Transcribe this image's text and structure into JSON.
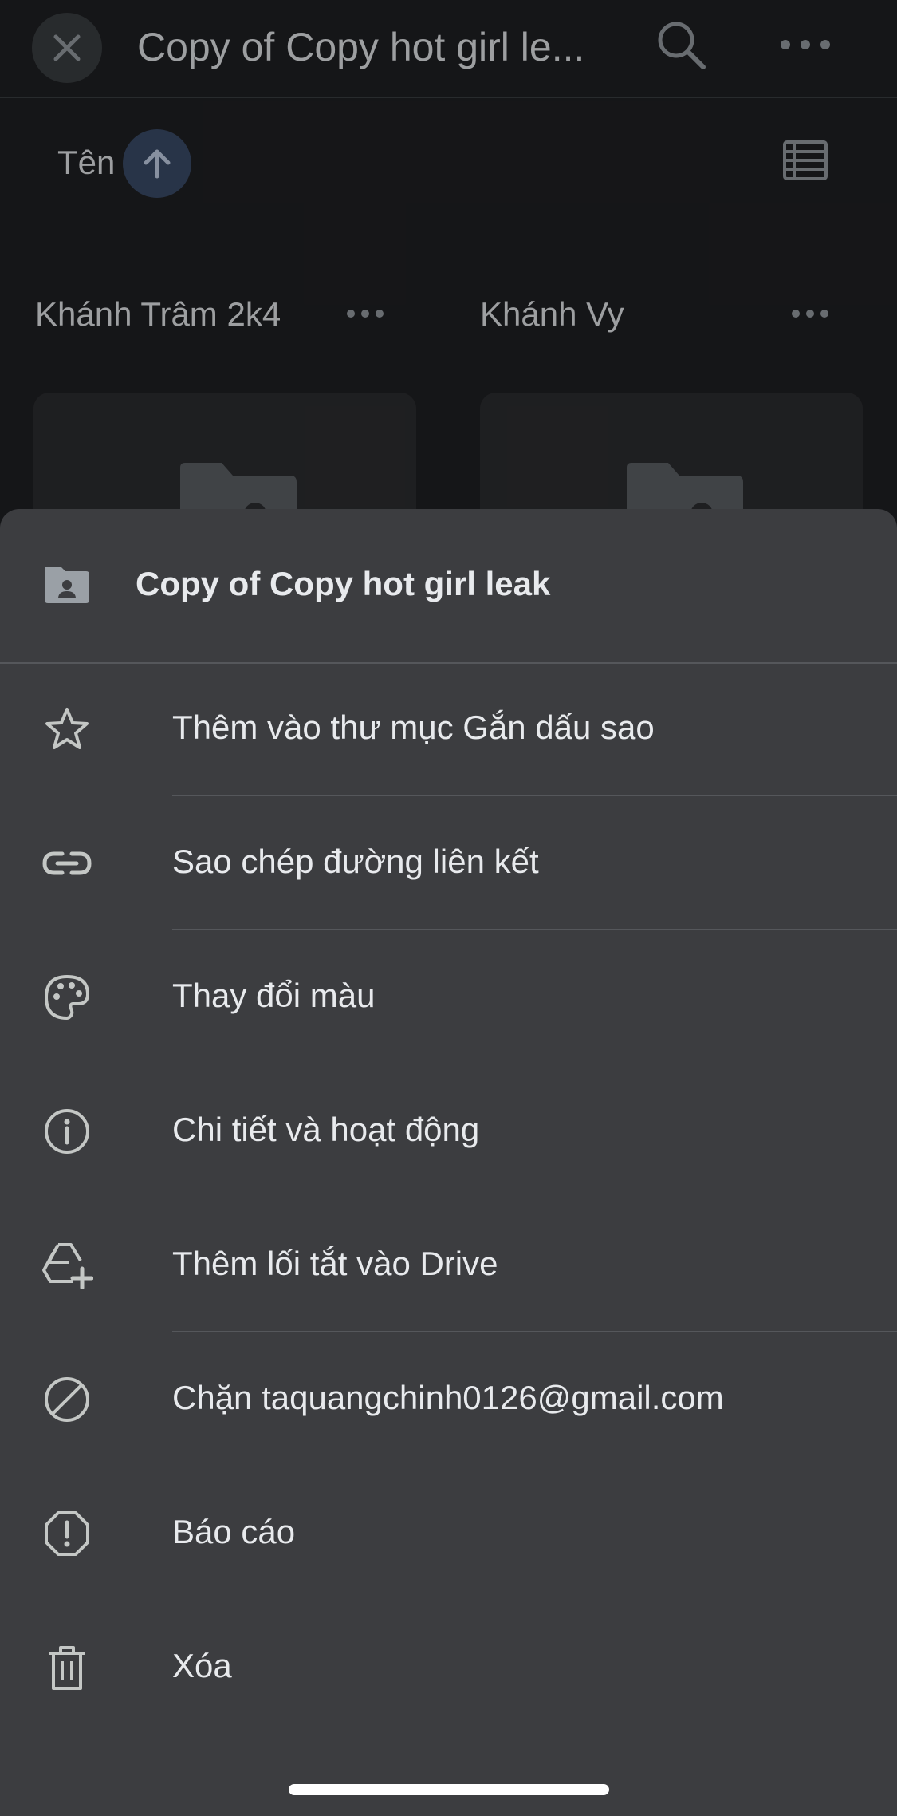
{
  "top_bar": {
    "title": "Copy of Copy hot girl le...",
    "close_icon": "close-icon",
    "search_icon": "search-icon",
    "more_icon": "more-horiz-icon"
  },
  "sort": {
    "label": "Tên",
    "direction_icon": "arrow-up-icon",
    "view_icon": "list-view-icon"
  },
  "folders": [
    {
      "name": "Khánh Trâm 2k4"
    },
    {
      "name": "Khánh Vy"
    }
  ],
  "sheet": {
    "title": "Copy of Copy hot girl leak",
    "title_icon": "shared-folder-icon",
    "items": [
      {
        "label": "Thêm vào thư mục Gắn dấu sao",
        "icon": "star-icon"
      },
      {
        "label": "Sao chép đường liên kết",
        "icon": "link-icon"
      },
      {
        "label": "Thay đổi màu",
        "icon": "palette-icon"
      },
      {
        "label": "Chi tiết và hoạt động",
        "icon": "info-icon"
      },
      {
        "label": "Thêm lối tắt vào Drive",
        "icon": "add-to-drive-icon"
      },
      {
        "label": "Chặn taquangchinh0126@gmail.com",
        "icon": "block-icon"
      },
      {
        "label": "Báo cáo",
        "icon": "report-icon"
      },
      {
        "label": "Xóa",
        "icon": "trash-icon"
      }
    ]
  },
  "colors": {
    "background": "#202124",
    "sheet": "#3c3d40",
    "text": "#e8eaed",
    "icon": "#c4c7c5",
    "sort_button": "#3c4d6b"
  }
}
